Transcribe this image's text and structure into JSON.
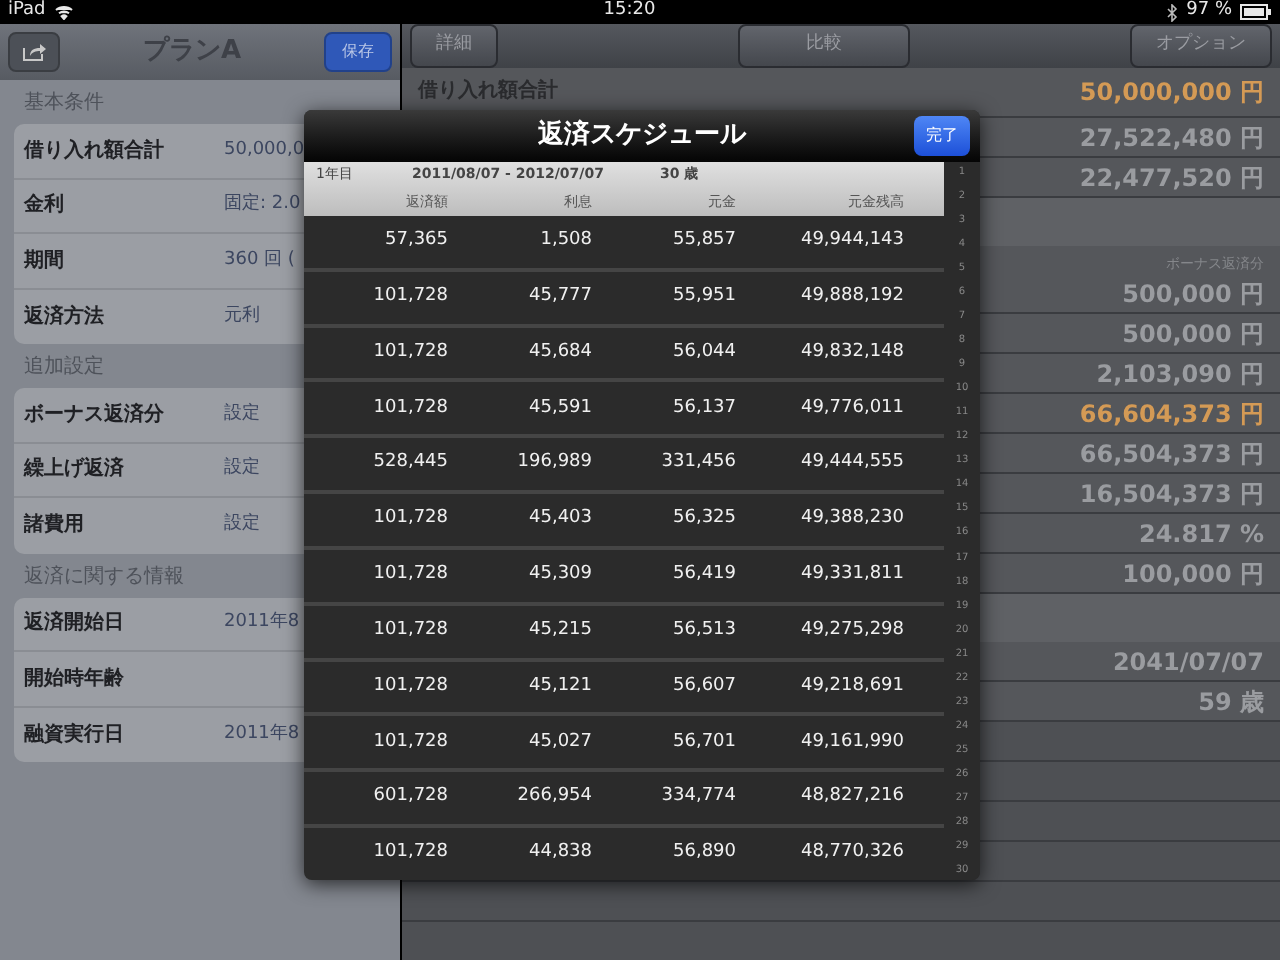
{
  "status_bar": {
    "device": "iPad",
    "time": "15:20",
    "battery": "97 %"
  },
  "left_panel": {
    "title": "プランA",
    "save_button": "保存",
    "sections": [
      {
        "header": "基本条件",
        "rows": [
          {
            "label": "借り入れ額合計",
            "value": "50,000,0"
          },
          {
            "label": "金利",
            "value": "固定: 2.0"
          },
          {
            "label": "期間",
            "value": "360 回 ("
          },
          {
            "label": "返済方法",
            "value": "元利"
          }
        ]
      },
      {
        "header": "追加設定",
        "rows": [
          {
            "label": "ボーナス返済分",
            "value": "設定"
          },
          {
            "label": "繰上げ返済",
            "value": "設定"
          },
          {
            "label": "諸費用",
            "value": "設定"
          }
        ]
      },
      {
        "header": "返済に関する情報",
        "rows": [
          {
            "label": "返済開始日",
            "value": "2011年8"
          },
          {
            "label": "開始時年齢"
          },
          {
            "label": "融資実行日",
            "value": "2011年8"
          }
        ]
      }
    ]
  },
  "right_panel": {
    "buttons": [
      "詳細",
      "比較",
      "オプション"
    ],
    "rows": [
      {
        "kind": "value",
        "label": "借り入れ額合計",
        "value": "50,000,000 円",
        "highlighted": true
      },
      {
        "kind": "value",
        "value": "27,522,480 円",
        "highlighted": false
      },
      {
        "kind": "value",
        "value": "22,477,520 円",
        "highlighted": false
      },
      {
        "kind": "spacer"
      },
      {
        "kind": "header",
        "text": "ボーナス返済分"
      },
      {
        "kind": "value",
        "value": "500,000 円",
        "highlighted": false
      },
      {
        "kind": "value",
        "value": "500,000 円",
        "highlighted": false
      },
      {
        "kind": "value",
        "value": "2,103,090 円",
        "highlighted": false
      },
      {
        "kind": "value",
        "value": "66,604,373 円",
        "highlighted": true
      },
      {
        "kind": "value",
        "value": "66,504,373 円",
        "highlighted": false
      },
      {
        "kind": "value",
        "value": "16,504,373 円",
        "highlighted": false
      },
      {
        "kind": "value",
        "value": "24.817 %",
        "highlighted": false
      },
      {
        "kind": "value",
        "value": "100,000 円",
        "highlighted": false
      },
      {
        "kind": "spacer"
      },
      {
        "kind": "value",
        "value": "2041/07/07",
        "highlighted": false
      },
      {
        "kind": "value",
        "value": "59 歳",
        "highlighted": false
      },
      {
        "kind": "empty"
      },
      {
        "kind": "empty"
      },
      {
        "kind": "empty"
      },
      {
        "kind": "empty"
      },
      {
        "kind": "empty"
      },
      {
        "kind": "empty"
      }
    ]
  },
  "schedule_dialog": {
    "title": "返済スケジュール",
    "done_button": "完了",
    "year": "1年目",
    "period": "2011/08/07 - 2012/07/07",
    "age": "30 歳",
    "columns": [
      "返済額",
      "利息",
      "元金",
      "元金残高"
    ],
    "rows": [
      [
        "57,365",
        "1,508",
        "55,857",
        "49,944,143"
      ],
      [
        "101,728",
        "45,777",
        "55,951",
        "49,888,192"
      ],
      [
        "101,728",
        "45,684",
        "56,044",
        "49,832,148"
      ],
      [
        "101,728",
        "45,591",
        "56,137",
        "49,776,011"
      ],
      [
        "528,445",
        "196,989",
        "331,456",
        "49,444,555"
      ],
      [
        "101,728",
        "45,403",
        "56,325",
        "49,388,230"
      ],
      [
        "101,728",
        "45,309",
        "56,419",
        "49,331,811"
      ],
      [
        "101,728",
        "45,215",
        "56,513",
        "49,275,298"
      ],
      [
        "101,728",
        "45,121",
        "56,607",
        "49,218,691"
      ],
      [
        "101,728",
        "45,027",
        "56,701",
        "49,161,990"
      ],
      [
        "601,728",
        "266,954",
        "334,774",
        "48,827,216"
      ],
      [
        "101,728",
        "44,838",
        "56,890",
        "48,770,326"
      ]
    ],
    "index": [
      "1",
      "2",
      "3",
      "4",
      "5",
      "6",
      "7",
      "8",
      "9",
      "10",
      "11",
      "12",
      "13",
      "14",
      "15",
      "16",
      "17",
      "18",
      "19",
      "20",
      "21",
      "22",
      "23",
      "24",
      "25",
      "26",
      "27",
      "28",
      "29",
      "30"
    ]
  }
}
